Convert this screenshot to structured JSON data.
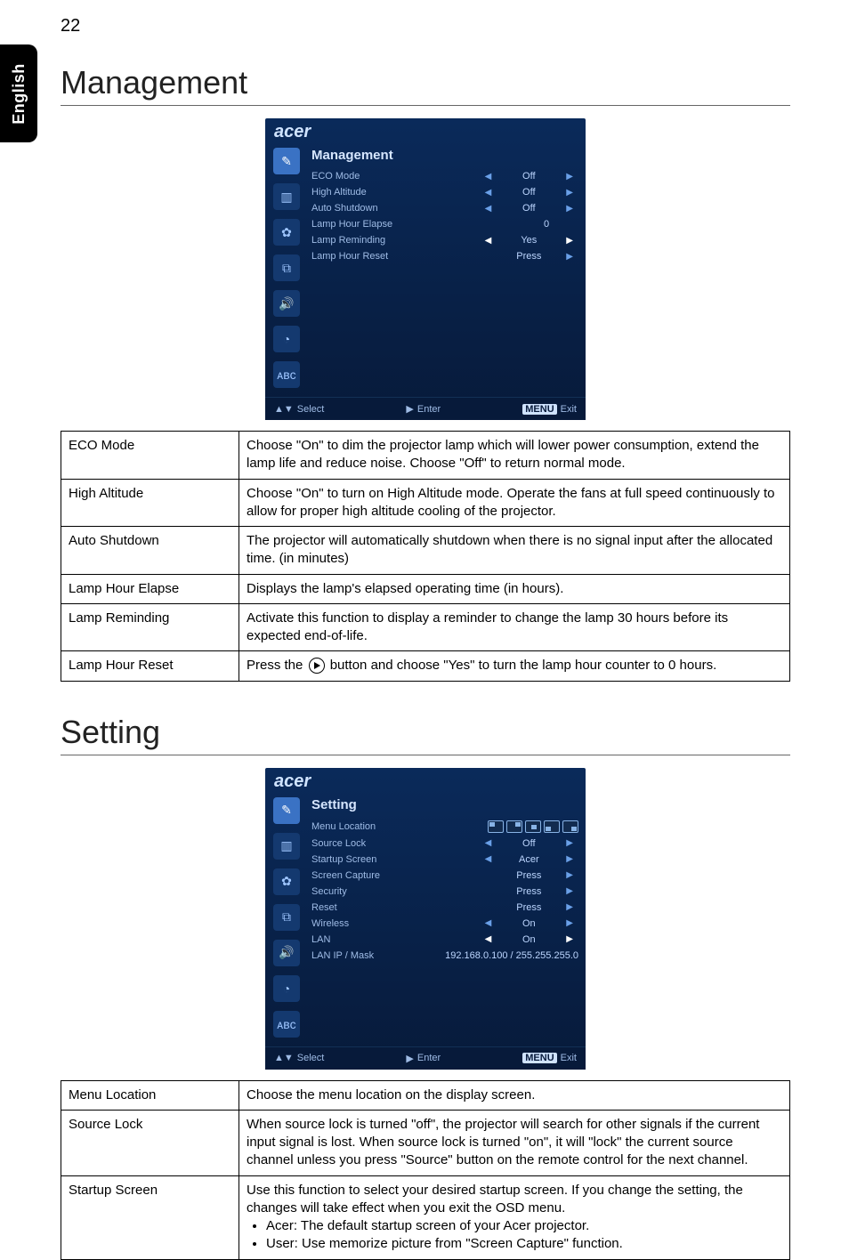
{
  "page_number": "22",
  "side_tab": "English",
  "brand": "acer",
  "sections": {
    "management": {
      "heading": "Management",
      "osd_title": "Management",
      "osd_rows": [
        {
          "label": "ECO Mode",
          "value": "Off",
          "sel": false
        },
        {
          "label": "High Altitude",
          "value": "Off",
          "sel": false
        },
        {
          "label": "Auto Shutdown",
          "value": "Off",
          "sel": false
        },
        {
          "label": "Lamp Hour Elapse",
          "value": "0",
          "sel": false,
          "noarrows": true
        },
        {
          "label": "Lamp Reminding",
          "value": "Yes",
          "sel": true
        },
        {
          "label": "Lamp Hour Reset",
          "value": "Press",
          "sel": false,
          "noleft": true
        }
      ],
      "osd_foot": {
        "select": "Select",
        "enter": "Enter",
        "exit": "Exit",
        "menu": "MENU"
      },
      "table": [
        {
          "label": "ECO Mode",
          "desc": "Choose \"On\" to dim the projector lamp which will lower power consumption, extend the lamp life and reduce noise.  Choose \"Off\" to return normal mode."
        },
        {
          "label": "High Altitude",
          "desc": "Choose \"On\" to turn on High Altitude mode. Operate the fans at full speed continuously to allow for proper high altitude cooling of the projector."
        },
        {
          "label": "Auto Shutdown",
          "desc": "The projector will automatically shutdown when there is no signal input after the allocated time. (in minutes)"
        },
        {
          "label": "Lamp Hour Elapse",
          "desc": "Displays the lamp's elapsed operating time (in hours)."
        },
        {
          "label": "Lamp Reminding",
          "desc": "Activate this function to display a reminder to change the lamp 30 hours before its expected end-of-life."
        },
        {
          "label": "Lamp Hour Reset",
          "desc_pre": "Press the ",
          "desc_post": " button and choose \"Yes\" to turn the lamp hour counter to 0 hours.",
          "has_icon": true
        }
      ]
    },
    "setting": {
      "heading": "Setting",
      "osd_title": "Setting",
      "osd_rows": [
        {
          "label": "Menu Location",
          "type": "loc"
        },
        {
          "label": "Source Lock",
          "value": "Off",
          "sel": false
        },
        {
          "label": "Startup Screen",
          "value": "Acer",
          "sel": false
        },
        {
          "label": "Screen Capture",
          "value": "Press",
          "sel": false,
          "noleft": true
        },
        {
          "label": "Security",
          "value": "Press",
          "sel": false,
          "noleft": true
        },
        {
          "label": "Reset",
          "value": "Press",
          "sel": false,
          "noleft": true
        },
        {
          "label": "Wireless",
          "value": "On",
          "sel": false
        },
        {
          "label": "LAN",
          "value": "On",
          "sel": true
        },
        {
          "label": "LAN IP / Mask",
          "value": "192.168.0.100 / 255.255.255.0",
          "sel": false,
          "noarrows": true,
          "wide": true
        }
      ],
      "osd_foot": {
        "select": "Select",
        "enter": "Enter",
        "exit": "Exit",
        "menu": "MENU"
      },
      "table": [
        {
          "label": "Menu Location",
          "desc": "Choose the menu location on the display screen."
        },
        {
          "label": "Source Lock",
          "desc": "When source lock is turned \"off\", the projector will search for other signals if the current input signal is lost. When source lock is turned \"on\", it will \"lock\" the current source channel unless you press \"Source\" button on the remote control for the next channel."
        },
        {
          "label": "Startup Screen",
          "desc": "Use this function to select your desired startup screen. If you change the setting, the changes will take effect when you exit the OSD menu.",
          "bullets": [
            "Acer: The default startup screen of your Acer projector.",
            "User: Use memorize picture from \"Screen Capture\" function."
          ]
        }
      ]
    }
  }
}
